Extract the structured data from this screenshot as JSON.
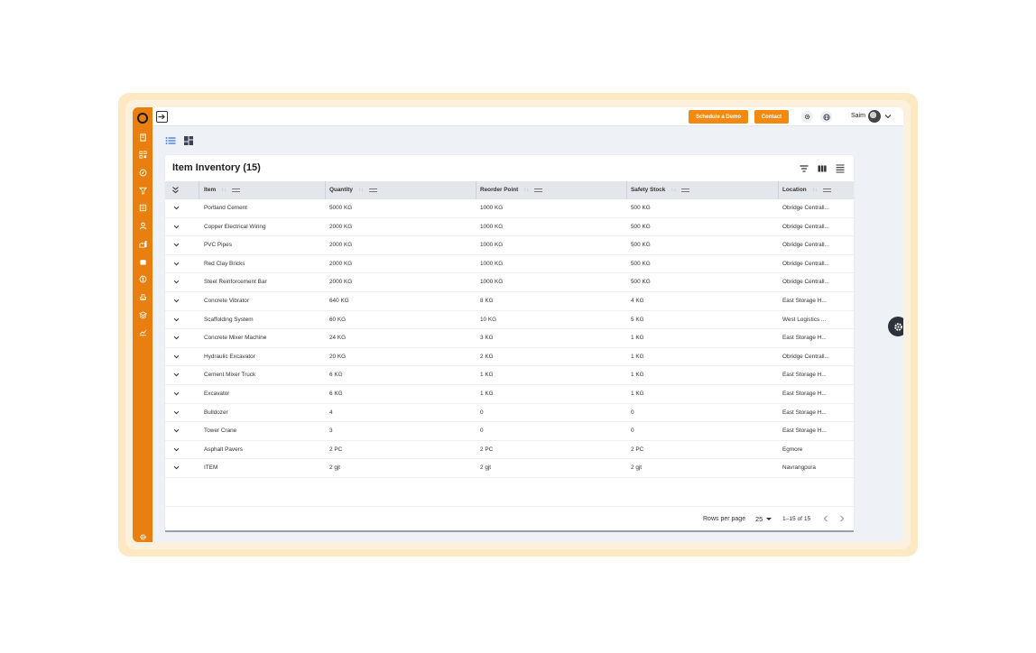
{
  "header": {
    "schedule_demo": "Schedule a Demo",
    "contact": "Contact",
    "user_name": "Saim"
  },
  "colors": {
    "brand": "#e97f0e",
    "button": "#f28a12"
  },
  "sidebar": {
    "icons": [
      "building-icon",
      "qr-code-icon",
      "compass-icon",
      "filter-funnel-icon",
      "invoice-icon",
      "user-icon",
      "factory-icon",
      "box-icon",
      "dollar-icon",
      "stamp-icon",
      "layers-icon",
      "trend-chart-icon"
    ],
    "bottom_icon": "gear-icon"
  },
  "table": {
    "title": "Item Inventory (15)",
    "columns": [
      "Item",
      "Quantity",
      "Reorder Point",
      "Safety Stock",
      "Location"
    ],
    "rows": [
      {
        "item": "Portland Cement",
        "quantity": "5000 KG",
        "reorder": "1000 KG",
        "safety": "500 KG",
        "location": "Obridge Centrall..."
      },
      {
        "item": "Copper Electrical Wiring",
        "quantity": "2000 KG",
        "reorder": "1000 KG",
        "safety": "500 KG",
        "location": "Obridge Centrall..."
      },
      {
        "item": "PVC Pipes",
        "quantity": "2000 KG",
        "reorder": "1000 KG",
        "safety": "500 KG",
        "location": "Obridge Centrall..."
      },
      {
        "item": "Red Clay Bricks",
        "quantity": "2000 KG",
        "reorder": "1000 KG",
        "safety": "500 KG",
        "location": "Obridge Centrall..."
      },
      {
        "item": "Steel Reinforcement Bar",
        "quantity": "2000 KG",
        "reorder": "1000 KG",
        "safety": "500 KG",
        "location": "Obridge Centrall..."
      },
      {
        "item": "Concrete Vibrator",
        "quantity": "640 KG",
        "reorder": "8 KG",
        "safety": "4 KG",
        "location": "East Storage H..."
      },
      {
        "item": "Scaffolding System",
        "quantity": "60 KG",
        "reorder": "10 KG",
        "safety": "5 KG",
        "location": "West Logistics ..."
      },
      {
        "item": "Concrete Mixer Machine",
        "quantity": "24 KG",
        "reorder": "3 KG",
        "safety": "1 KG",
        "location": "East Storage H..."
      },
      {
        "item": "Hydraulic Excavator",
        "quantity": "20 KG",
        "reorder": "2 KG",
        "safety": "1 KG",
        "location": "Obridge Centrall..."
      },
      {
        "item": "Cement Mixer Truck",
        "quantity": "6 KG",
        "reorder": "1 KG",
        "safety": "1 KG",
        "location": "East Storage H..."
      },
      {
        "item": "Excavator",
        "quantity": "6 KG",
        "reorder": "1 KG",
        "safety": "1 KG",
        "location": "East Storage H..."
      },
      {
        "item": "Bulldozer",
        "quantity": "4",
        "reorder": "0",
        "safety": "0",
        "location": "East Storage H..."
      },
      {
        "item": "Tower Crane",
        "quantity": "3",
        "reorder": "0",
        "safety": "0",
        "location": "East Storage H..."
      },
      {
        "item": "Asphalt Pavers",
        "quantity": "2 PC",
        "reorder": "2 PC",
        "safety": "2 PC",
        "location": "Egmore"
      },
      {
        "item": "ITEM",
        "quantity": "2 gjt",
        "reorder": "2 gjt",
        "safety": "2 gjt",
        "location": "Navrangpura"
      }
    ]
  },
  "pagination": {
    "rows_per_page_label": "Rows per page",
    "rows_per_page_value": "25",
    "range": "1–15 of 15"
  }
}
